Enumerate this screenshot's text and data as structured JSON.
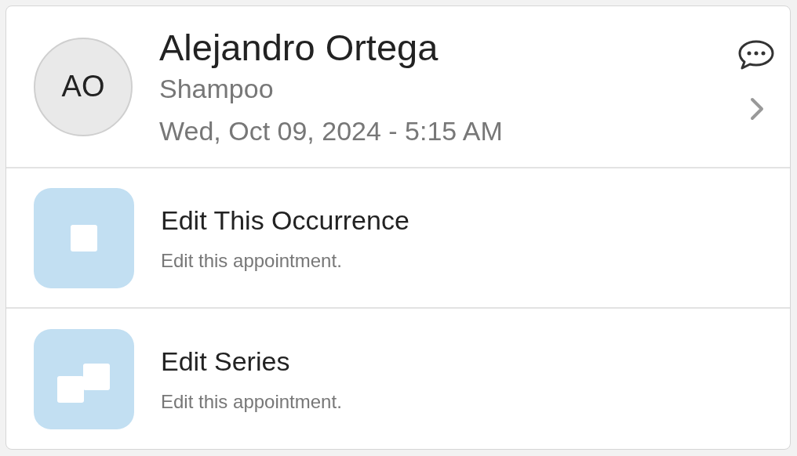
{
  "appointment": {
    "initials": "AO",
    "client_name": "Alejandro Ortega",
    "service": "Shampoo",
    "date_time": "Wed, Oct 09, 2024 - 5:15 AM"
  },
  "options": [
    {
      "kind": "single",
      "title": "Edit This Occurrence",
      "description": "Edit this appointment."
    },
    {
      "kind": "series",
      "title": "Edit Series",
      "description": "Edit this appointment."
    }
  ]
}
